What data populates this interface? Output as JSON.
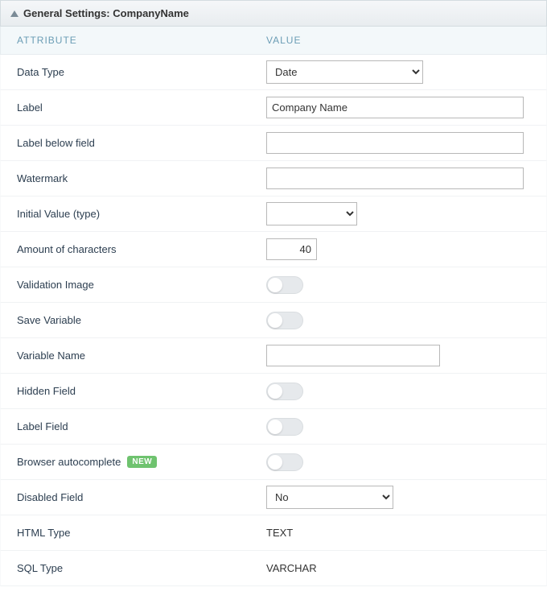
{
  "panel": {
    "title": "General Settings: CompanyName"
  },
  "headers": {
    "attribute": "ATTRIBUTE",
    "value": "VALUE"
  },
  "rows": {
    "data_type": {
      "label": "Data Type",
      "value": "Date"
    },
    "label": {
      "label": "Label",
      "value": "Company Name"
    },
    "label_below": {
      "label": "Label below field",
      "value": ""
    },
    "watermark": {
      "label": "Watermark",
      "value": ""
    },
    "initial_value_type": {
      "label": "Initial Value (type)",
      "value": ""
    },
    "amount_chars": {
      "label": "Amount of characters",
      "value": "40"
    },
    "validation_image": {
      "label": "Validation Image",
      "on": false
    },
    "save_variable": {
      "label": "Save Variable",
      "on": false
    },
    "variable_name": {
      "label": "Variable Name",
      "value": ""
    },
    "hidden_field": {
      "label": "Hidden Field",
      "on": false
    },
    "label_field": {
      "label": "Label Field",
      "on": false
    },
    "browser_autocomplete": {
      "label": "Browser autocomplete",
      "badge": "NEW",
      "on": false
    },
    "disabled_field": {
      "label": "Disabled Field",
      "value": "No"
    },
    "html_type": {
      "label": "HTML Type",
      "value": "TEXT"
    },
    "sql_type": {
      "label": "SQL Type",
      "value": "VARCHAR"
    }
  }
}
